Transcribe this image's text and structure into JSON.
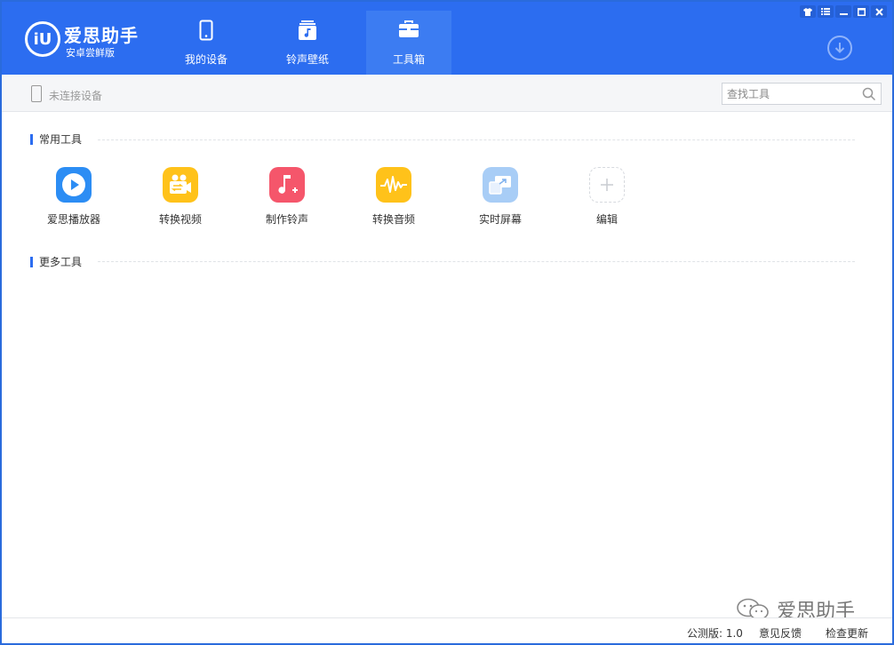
{
  "app": {
    "title": "爱思助手",
    "subtitle": "安卓尝鲜版",
    "logo_text": "iU"
  },
  "nav": {
    "tabs": [
      {
        "label": "我的设备",
        "icon": "phone-icon"
      },
      {
        "label": "铃声壁纸",
        "icon": "music-note-icon"
      },
      {
        "label": "工具箱",
        "icon": "toolbox-icon",
        "active": true
      }
    ]
  },
  "window_controls": [
    "shirt-icon",
    "menu-icon",
    "minimize-icon",
    "maximize-icon",
    "close-icon"
  ],
  "toolbar": {
    "device_status": "未连接设备",
    "search_placeholder": "查找工具"
  },
  "sections": {
    "common": "常用工具",
    "more": "更多工具"
  },
  "tools": [
    {
      "label": "爱思播放器",
      "icon": "play-icon",
      "color": "#2c8df4"
    },
    {
      "label": "转换视频",
      "icon": "video-convert-icon",
      "color": "#ffc21a"
    },
    {
      "label": "制作铃声",
      "icon": "ringtone-icon",
      "color": "#f5566b"
    },
    {
      "label": "转换音频",
      "icon": "audio-wave-icon",
      "color": "#ffc21a"
    },
    {
      "label": "实时屏幕",
      "icon": "screen-mirror-icon",
      "color": "#a8cdf6"
    },
    {
      "label": "编辑",
      "icon": "plus-icon",
      "color": "#ffffff"
    }
  ],
  "footer": {
    "version": "公测版: 1.0",
    "feedback": "意见反馈",
    "update": "检查更新"
  },
  "watermark": "爱思助手",
  "colors": {
    "brand": "#2c6df0",
    "active_tab": "#3c7cf2"
  }
}
